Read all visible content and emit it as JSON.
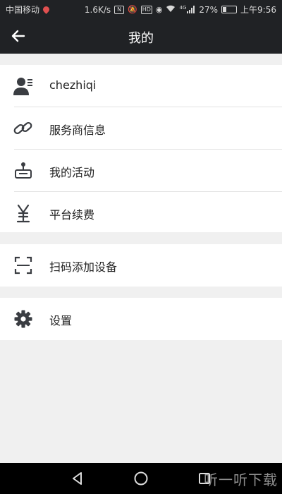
{
  "statusbar": {
    "carrier": "中国移动",
    "speed": "1.6K/s",
    "battery": "27%",
    "time": "上午9:56",
    "hd": "HD",
    "nfc": "N",
    "signal_label": "4G"
  },
  "header": {
    "title": "我的"
  },
  "menu": {
    "items": [
      {
        "label": "chezhiqi",
        "icon": "user-card-icon"
      },
      {
        "label": "服务商信息",
        "icon": "link-icon"
      },
      {
        "label": "我的活动",
        "icon": "joystick-icon"
      },
      {
        "label": "平台续费",
        "icon": "yen-icon"
      },
      {
        "label": "扫码添加设备",
        "icon": "scan-icon"
      },
      {
        "label": "设置",
        "icon": "gear-icon"
      }
    ]
  },
  "watermark": {
    "text": "听一听下载"
  },
  "colors": {
    "bar": "#202225",
    "background": "#f0f0f0",
    "icon": "#3a3d42"
  }
}
